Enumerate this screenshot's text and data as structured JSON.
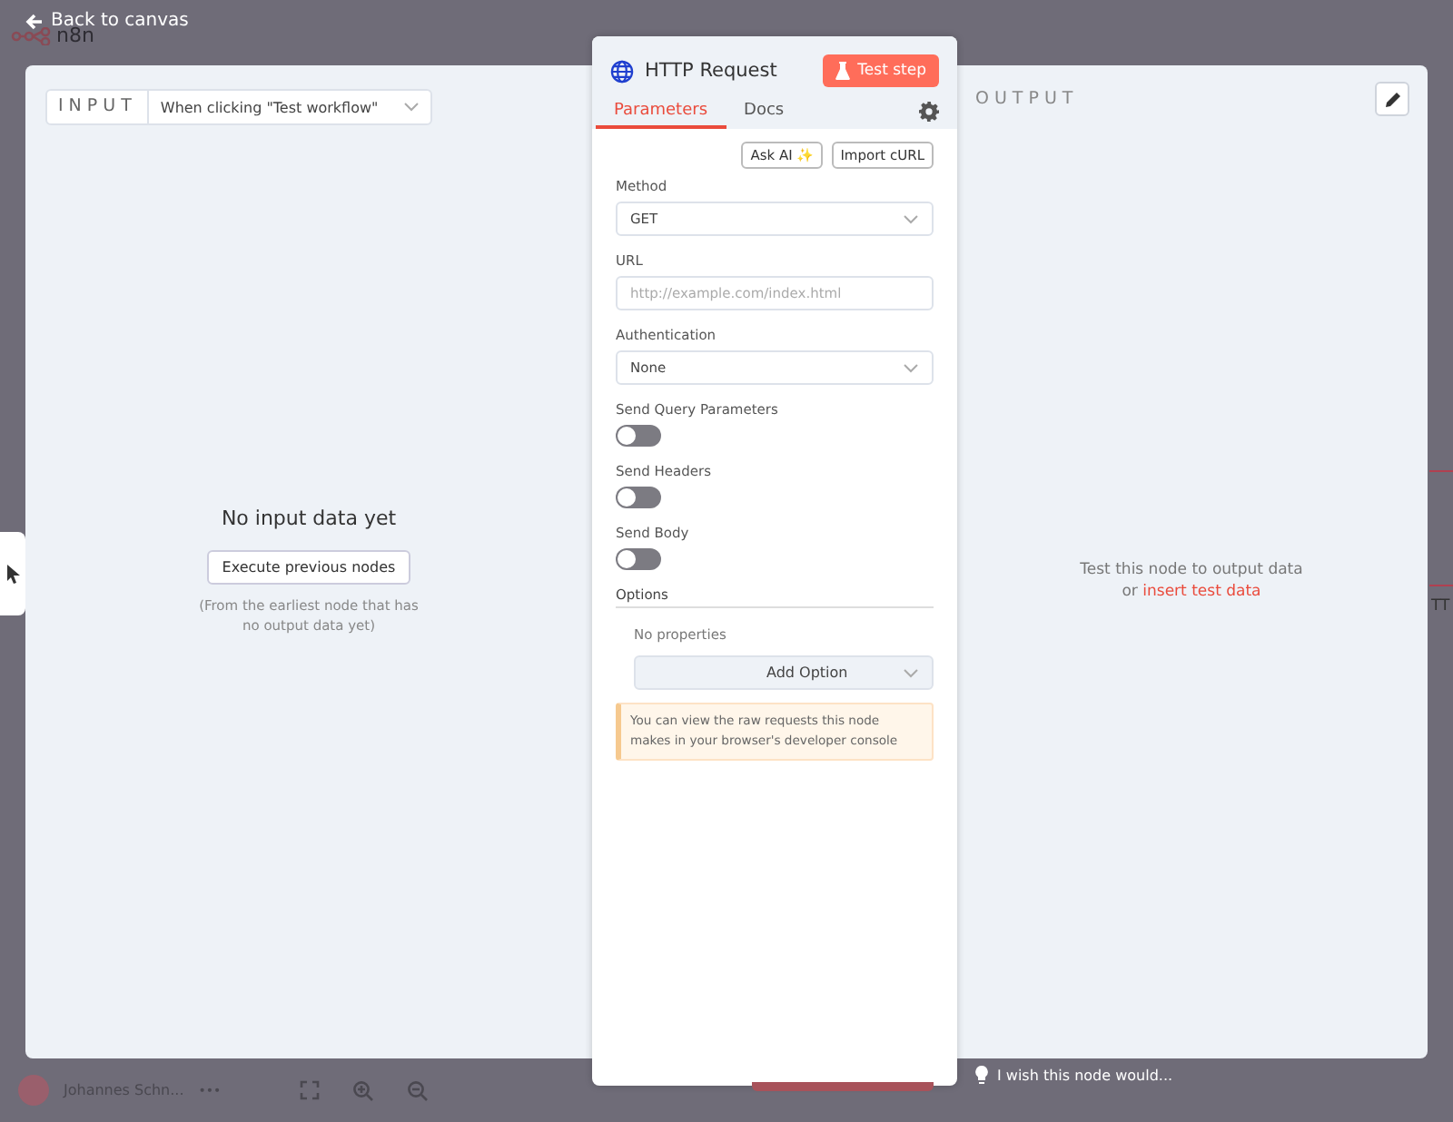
{
  "canvas": {
    "logo": "n8n",
    "back_link": "Back to canvas",
    "edge_text": "TT"
  },
  "input_panel": {
    "label": "INPUT",
    "trigger_select": "When clicking \"Test workflow\"",
    "empty_title": "No input data yet",
    "execute_button": "Execute previous nodes",
    "hint": "(From the earliest node that has no output data yet)"
  },
  "node": {
    "title": "HTTP Request",
    "test_button": "Test step",
    "tabs": [
      {
        "label": "Parameters",
        "selected": true
      },
      {
        "label": "Docs",
        "selected": false
      }
    ],
    "actions": [
      "Ask AI ✨",
      "Import cURL"
    ],
    "fields": [
      {
        "kind": "select",
        "label": "Method",
        "value": "GET"
      },
      {
        "kind": "input",
        "label": "URL",
        "placeholder": "http://example.com/index.html"
      },
      {
        "kind": "select",
        "label": "Authentication",
        "value": "None"
      },
      {
        "kind": "toggle",
        "label": "Send Query Parameters",
        "on": false
      },
      {
        "kind": "toggle",
        "label": "Send Headers",
        "on": false
      },
      {
        "kind": "toggle",
        "label": "Send Body",
        "on": false
      }
    ],
    "options": {
      "heading": "Options",
      "empty": "No properties",
      "add_button": "Add Option"
    },
    "notice": "You can view the raw requests this node makes in your browser's developer console"
  },
  "output_panel": {
    "label": "OUTPUT",
    "message": "Test this node to output data",
    "link_prefix": "or",
    "link": "insert test data"
  },
  "footer": {
    "user": "Johannes Schn...",
    "more": "•••",
    "feedback": "I wish this node would..."
  }
}
